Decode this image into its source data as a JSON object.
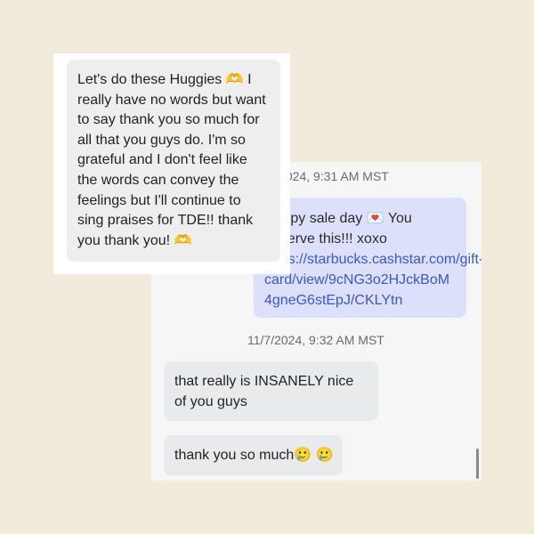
{
  "chat": {
    "timestamp_1": "11/7/2024, 9:31 AM MST",
    "outgoing_lines": [
      "Happy sale day 💌 You",
      "deserve this!!! xoxo"
    ],
    "outgoing_link_lines": [
      "https://starbucks.cashstar.com/gift-",
      "card/view/9cNG3o2HJckBoM",
      "4gneG6stEpJ/CKLYtn"
    ],
    "timestamp_2": "11/7/2024, 9:32 AM MST",
    "incoming_1": "that really is INSANELY nice of you guys",
    "incoming_2": "thank you so much🥲 🥲"
  },
  "front_card": {
    "lines": [
      "Let's do these Huggies 🫶 I",
      "really have no words but want",
      "to say thank you so much for",
      "all that you guys do. I'm so",
      "grateful and I don't feel like",
      "the words can convey the",
      "feelings but I'll continue to",
      "sing praises for TDE!! thank",
      "you thank you! 🫶"
    ]
  },
  "colors": {
    "background": "#f2eadb",
    "outgoing_bubble": "#dde0fb",
    "incoming_bubble": "#e9eaec",
    "link": "#3b57c9"
  }
}
